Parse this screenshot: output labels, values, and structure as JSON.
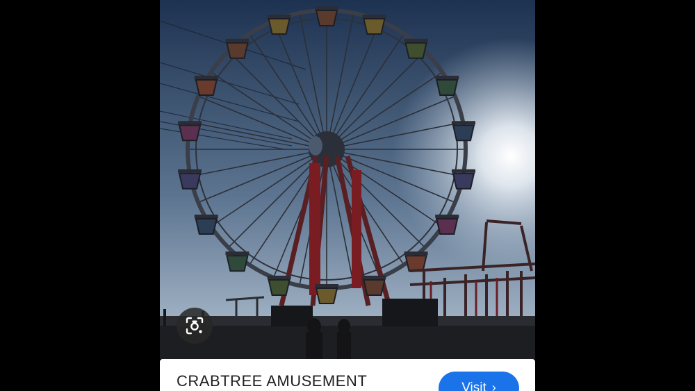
{
  "result": {
    "title": "CRABTREE AMUSEMENT",
    "visit_label": "Visit",
    "visit_icon": "chevron-right-icon",
    "lens_icon": "camera-search-icon"
  },
  "colors": {
    "accent": "#1a73e8",
    "sky_top": "#1e3350",
    "sky_bottom": "#a9bdd1"
  }
}
